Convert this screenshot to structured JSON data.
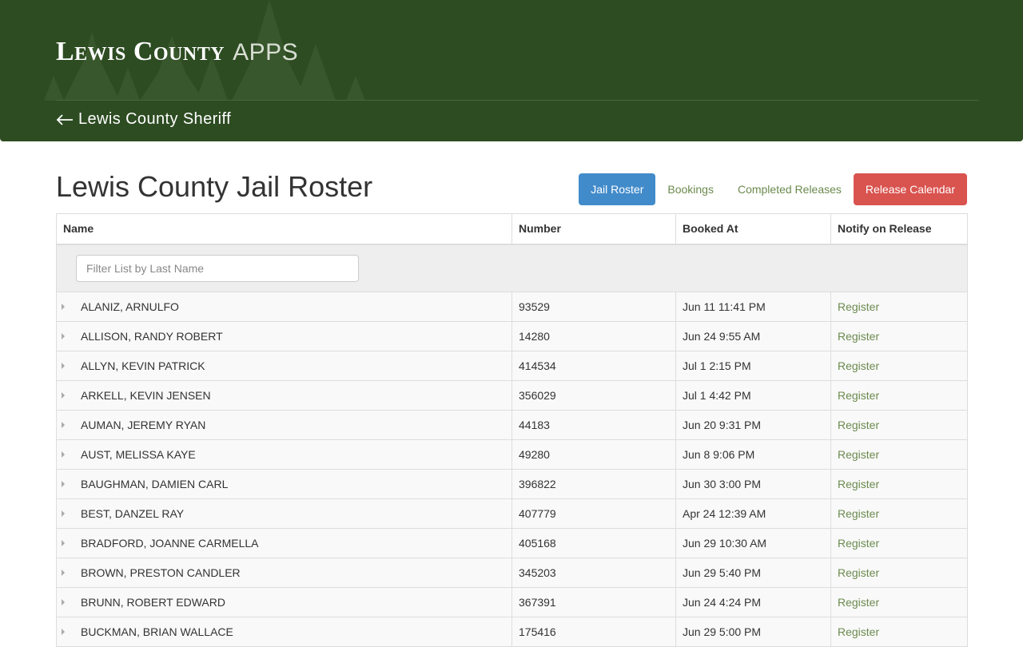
{
  "header": {
    "brand_main": "Lewis County",
    "brand_sub": "APPS",
    "back_link": "Lewis County Sheriff"
  },
  "page": {
    "title": "Lewis County Jail Roster"
  },
  "nav": {
    "items": [
      {
        "label": "Jail Roster",
        "state": "active"
      },
      {
        "label": "Bookings",
        "state": "link"
      },
      {
        "label": "Completed Releases",
        "state": "link"
      },
      {
        "label": "Release Calendar",
        "state": "danger"
      }
    ]
  },
  "table": {
    "columns": [
      "Name",
      "Number",
      "Booked At",
      "Notify on Release"
    ],
    "filter_placeholder": "Filter List by Last Name",
    "register_label": "Register",
    "rows": [
      {
        "name": "ALANIZ, ARNULFO",
        "number": "93529",
        "booked_at": "Jun 11 11:41 PM"
      },
      {
        "name": "ALLISON, RANDY ROBERT",
        "number": "14280",
        "booked_at": "Jun 24 9:55 AM"
      },
      {
        "name": "ALLYN, KEVIN PATRICK",
        "number": "414534",
        "booked_at": "Jul 1 2:15 PM"
      },
      {
        "name": "ARKELL, KEVIN JENSEN",
        "number": "356029",
        "booked_at": "Jul 1 4:42 PM"
      },
      {
        "name": "AUMAN, JEREMY RYAN",
        "number": "44183",
        "booked_at": "Jun 20 9:31 PM"
      },
      {
        "name": "AUST, MELISSA KAYE",
        "number": "49280",
        "booked_at": "Jun 8 9:06 PM"
      },
      {
        "name": "BAUGHMAN, DAMIEN CARL",
        "number": "396822",
        "booked_at": "Jun 30 3:00 PM"
      },
      {
        "name": "BEST, DANZEL RAY",
        "number": "407779",
        "booked_at": "Apr 24 12:39 AM"
      },
      {
        "name": "BRADFORD, JOANNE CARMELLA",
        "number": "405168",
        "booked_at": "Jun 29 10:30 AM"
      },
      {
        "name": "BROWN, PRESTON CANDLER",
        "number": "345203",
        "booked_at": "Jun 29 5:40 PM"
      },
      {
        "name": "BRUNN, ROBERT EDWARD",
        "number": "367391",
        "booked_at": "Jun 24 4:24 PM"
      },
      {
        "name": "BUCKMAN, BRIAN WALLACE",
        "number": "175416",
        "booked_at": "Jun 29 5:00 PM"
      }
    ]
  },
  "colors": {
    "header_bg": "#2d4c22",
    "accent_green": "#6b8a4e",
    "primary_blue": "#428bca",
    "danger_red": "#d9534f"
  }
}
